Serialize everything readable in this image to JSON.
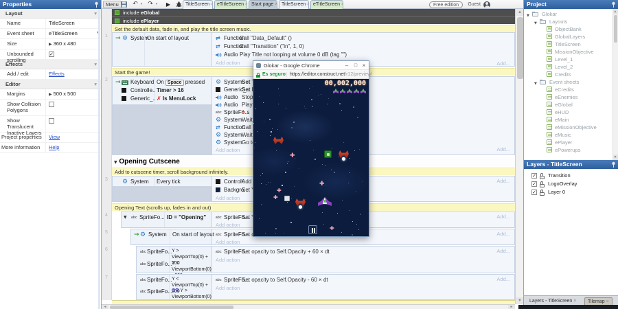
{
  "icons": {
    "check": "✓",
    "gear": "⚙",
    "function": "⇄",
    "trigger_arrow": "→",
    "collapse": "▼",
    "expand": "▶",
    "invert": "✗",
    "flash": "ϟ",
    "dropdown": "▾",
    "close": "×",
    "play": "▶",
    "undo": "↶",
    "redo": "↷"
  },
  "toolbar": {
    "menu": "Menu"
  },
  "tabs": [
    {
      "label": "TitleScreen"
    },
    {
      "label": "eTitleScreen"
    },
    {
      "label": "Start page"
    },
    {
      "label": "TitleScreen"
    },
    {
      "label": "eTitleScreen"
    }
  ],
  "account": {
    "edition": "Free edition",
    "user": "Guest"
  },
  "properties": {
    "title": "Properties",
    "sec_layout": "Layout",
    "sec_effects": "Effects",
    "sec_editor": "Editor",
    "name_label": "Name",
    "name_value": "TitleScreen",
    "sheet_label": "Event sheet",
    "sheet_value": "eTitleScreen",
    "size_label": "Size",
    "size_value": "360 x 480",
    "unbounded_label": "Unbounded scrolling",
    "addedit_label": "Add / edit",
    "addedit_link": "Effects",
    "margins_label": "Margins",
    "margins_value": "500 x 500",
    "collision_label": "Show Collision Polygons",
    "translucent_label": "Show Translucent Inactive Layers",
    "projprops_label": "Project properties",
    "projprops_link": "View",
    "moreinfo_label": "More information",
    "moreinfo_link": "Help"
  },
  "es": {
    "includes": [
      {
        "word": "include",
        "name": "eGlobal"
      },
      {
        "word": "include",
        "name": "ePlayer"
      }
    ],
    "comment1": "Set the default data, fade in, and play the title screen music.",
    "comment2": "Start the game!",
    "comment3": "Add to cutscene timer, scroll background infinitely.",
    "comment4": "Opening Text (scrolls up, fades in and out)",
    "group_title": "Opening Cutscene",
    "add_action": "Add action",
    "add_link": "Add...",
    "e1": {
      "num": "1",
      "obj": "System",
      "cond": "On start of layout",
      "a1_obj": "Function",
      "a1_text": "Call \"Data_Default\" ()",
      "a2_obj": "Function",
      "a2_text": "Call \"Transition\" (\"in\", 1, 0)",
      "a3_obj": "Audio",
      "a3_text": "Play Title not looping at volume 0 dB (tag \"\")"
    },
    "e2": {
      "num": "2",
      "c1_obj": "Keyboard",
      "c1_pre": "On",
      "c1_key": "Space",
      "c1_post": "pressed",
      "c2_obj": "Controlle..",
      "c2_text": "Timer > 16",
      "c3_obj": "Generic_..",
      "c3_text": "Is MenuLock",
      "acts": [
        {
          "obj": "System",
          "text": "Set T"
        },
        {
          "obj": "Generic_..",
          "text": "Set M"
        },
        {
          "obj": "Audio",
          "text": "Stop"
        },
        {
          "obj": "Audio",
          "text": "Play S"
        },
        {
          "obj": "SpriteFo...",
          "text": "s"
        },
        {
          "obj": "System",
          "text": "Wait"
        },
        {
          "obj": "Function",
          "text": "Call \""
        },
        {
          "obj": "System",
          "text": "Wait"
        },
        {
          "obj": "System",
          "text": "Go to"
        }
      ]
    },
    "e3": {
      "num": "3",
      "obj": "System",
      "cond": "Every tick",
      "a1_obj": "Controll...",
      "a1_text": "Add",
      "a2_obj": "Backgro...",
      "a2_text": "Set Y"
    },
    "e4": {
      "num": "4",
      "obj": "SpriteFo...",
      "cond": "ID = \"Opening\"",
      "a1_obj": "SpriteFo...",
      "a1_text": "Set Y"
    },
    "e5": {
      "num": "5",
      "obj": "System",
      "cond": "On start of layout",
      "a1_obj": "SpriteFo...",
      "a1_text": "Set o"
    },
    "e6": {
      "num": "6",
      "c1_obj": "SpriteFo...",
      "c1_text": "Y > ViewportTop(0) + 200",
      "c2_obj": "SpriteFo...",
      "c2_text": "Y < ViewportBottom(0) - 200",
      "a1_obj": "SpriteFo...",
      "a1_text": "Set opacity to Self.Opacity + 60 × dt"
    },
    "e7": {
      "num": "7",
      "c1_obj": "SpriteFo...",
      "c1_text": "Y < ViewportTop(0) + 200",
      "c2_obj": "SpriteFo...",
      "c2_or": "OR",
      "c2_text": "Y > ViewportBottom(0) - 200",
      "a1_obj": "SpriteFo...",
      "a1_text": "Set opacity to Self.Opacity - 60 × dt"
    }
  },
  "chrome": {
    "title": "Glokar - Google Chrome",
    "secure": "Es seguro",
    "url": "https://editor.construct.net",
    "path": "/r12/preview/",
    "game": {
      "score": "00,002,000",
      "lives": 5
    }
  },
  "project": {
    "title": "Project",
    "items": [
      {
        "label": "Glokar"
      },
      {
        "label": "Layouts"
      },
      {
        "label": "ObjectBank"
      },
      {
        "label": "GlobalLayers"
      },
      {
        "label": "TitleScreen"
      },
      {
        "label": "MissionObjective"
      },
      {
        "label": "Level_1"
      },
      {
        "label": "Level_2"
      },
      {
        "label": "Credits"
      },
      {
        "label": "Event sheets"
      },
      {
        "label": "eCredits"
      },
      {
        "label": "eEnemies"
      },
      {
        "label": "eGlobal"
      },
      {
        "label": "eHUD"
      },
      {
        "label": "eMain"
      },
      {
        "label": "eMissionObjective"
      },
      {
        "label": "eMusic"
      },
      {
        "label": "ePlayer"
      },
      {
        "label": "ePowerups"
      }
    ]
  },
  "layers": {
    "title": "Layers - TitleScreen",
    "items": [
      {
        "label": "Transition"
      },
      {
        "label": "LogoOverlay"
      },
      {
        "label": "Layer 0"
      }
    ]
  },
  "bottom_tabs": [
    {
      "label": "Layers - TitleScreen"
    },
    {
      "label": "Tilemap"
    }
  ]
}
